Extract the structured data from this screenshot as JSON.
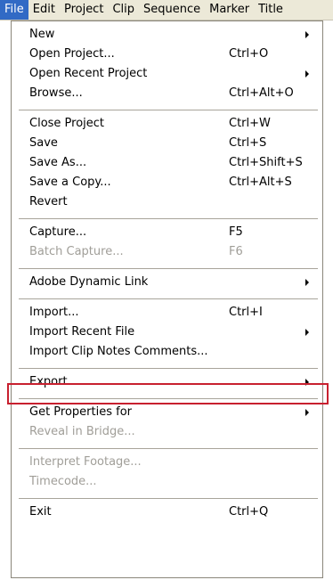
{
  "menubar": {
    "items": [
      "File",
      "Edit",
      "Project",
      "Clip",
      "Sequence",
      "Marker",
      "Title"
    ]
  },
  "menu": {
    "items": [
      {
        "label": "New",
        "shortcut": "",
        "submenu": true,
        "disabled": false
      },
      {
        "label": "Open Project...",
        "shortcut": "Ctrl+O",
        "submenu": false,
        "disabled": false
      },
      {
        "label": "Open Recent Project",
        "shortcut": "",
        "submenu": true,
        "disabled": false
      },
      {
        "label": "Browse...",
        "shortcut": "Ctrl+Alt+O",
        "submenu": false,
        "disabled": false
      },
      {
        "label": "Close Project",
        "shortcut": "Ctrl+W",
        "submenu": false,
        "disabled": false
      },
      {
        "label": "Save",
        "shortcut": "Ctrl+S",
        "submenu": false,
        "disabled": false
      },
      {
        "label": "Save As...",
        "shortcut": "Ctrl+Shift+S",
        "submenu": false,
        "disabled": false
      },
      {
        "label": "Save a Copy...",
        "shortcut": "Ctrl+Alt+S",
        "submenu": false,
        "disabled": false
      },
      {
        "label": "Revert",
        "shortcut": "",
        "submenu": false,
        "disabled": false
      },
      {
        "label": "Capture...",
        "shortcut": "F5",
        "submenu": false,
        "disabled": false
      },
      {
        "label": "Batch Capture...",
        "shortcut": "F6",
        "submenu": false,
        "disabled": true
      },
      {
        "label": "Adobe Dynamic Link",
        "shortcut": "",
        "submenu": true,
        "disabled": false
      },
      {
        "label": "Import...",
        "shortcut": "Ctrl+I",
        "submenu": false,
        "disabled": false
      },
      {
        "label": "Import Recent File",
        "shortcut": "",
        "submenu": true,
        "disabled": false
      },
      {
        "label": "Import Clip Notes Comments...",
        "shortcut": "",
        "submenu": false,
        "disabled": false
      },
      {
        "label": "Export",
        "shortcut": "",
        "submenu": true,
        "disabled": false
      },
      {
        "label": "Get Properties for",
        "shortcut": "",
        "submenu": true,
        "disabled": false
      },
      {
        "label": "Reveal in Bridge...",
        "shortcut": "",
        "submenu": false,
        "disabled": true
      },
      {
        "label": "Interpret Footage...",
        "shortcut": "",
        "submenu": false,
        "disabled": true
      },
      {
        "label": "Timecode...",
        "shortcut": "",
        "submenu": false,
        "disabled": true
      },
      {
        "label": "Exit",
        "shortcut": "Ctrl+Q",
        "submenu": false,
        "disabled": false
      }
    ]
  },
  "highlight_color": "#c8202f",
  "menubar_active_color": "#316ac5"
}
